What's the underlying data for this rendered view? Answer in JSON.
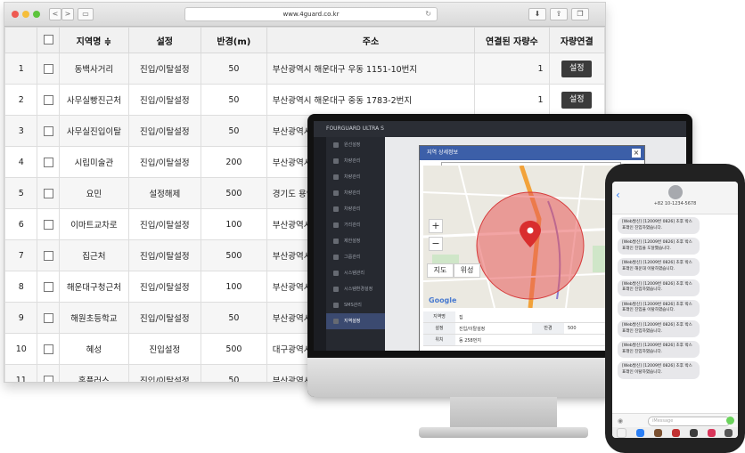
{
  "browser": {
    "url": "www.4guard.co.kr",
    "nav_back": "<",
    "nav_forward": ">"
  },
  "table": {
    "columns": [
      "지역명 ≑",
      "설정",
      "반경(m)",
      "주소",
      "연결된 자량수",
      "자량연결"
    ],
    "rows": [
      {
        "no": "1",
        "name": "동백사거리",
        "setting": "진입/이탈설정",
        "radius": "50",
        "address": "부산광역시 해운대구 우동 1151-10번지",
        "count": "1",
        "action": "설정"
      },
      {
        "no": "2",
        "name": "사무실빵진근처",
        "setting": "진입/이탈설정",
        "radius": "50",
        "address": "부산광역시 해운대구 중동 1783-2번지",
        "count": "1",
        "action": "설정"
      },
      {
        "no": "3",
        "name": "사무실진입이탈",
        "setting": "진입/이탈설정",
        "radius": "50",
        "address": "부산광역시 해운대구 중동",
        "count": "",
        "action": ""
      },
      {
        "no": "4",
        "name": "시립미술관",
        "setting": "진입/이탈설정",
        "radius": "200",
        "address": "부산광역시 ",
        "count": "",
        "action": ""
      },
      {
        "no": "5",
        "name": "요민",
        "setting": "설정해제",
        "radius": "500",
        "address": "경기도 용인",
        "count": "",
        "action": ""
      },
      {
        "no": "6",
        "name": "이마트교차로",
        "setting": "진입/이탈설정",
        "radius": "100",
        "address": "부산광역시 ",
        "count": "",
        "action": ""
      },
      {
        "no": "7",
        "name": "집근처",
        "setting": "진입/이탈설정",
        "radius": "500",
        "address": "부산광역시 ",
        "count": "",
        "action": ""
      },
      {
        "no": "8",
        "name": "해운대구청근처",
        "setting": "진입/이탈설정",
        "radius": "100",
        "address": "부산광역시 ",
        "count": "",
        "action": ""
      },
      {
        "no": "9",
        "name": "해원초등학교",
        "setting": "진입/이탈설정",
        "radius": "50",
        "address": "부산광역시 ",
        "count": "",
        "action": ""
      },
      {
        "no": "10",
        "name": "혜성",
        "setting": "진입설정",
        "radius": "500",
        "address": "대구광역시 ",
        "count": "",
        "action": ""
      },
      {
        "no": "11",
        "name": "홈플러스",
        "setting": "진입/이탈설정",
        "radius": "50",
        "address": "부산광역시 ",
        "count": "",
        "action": ""
      }
    ]
  },
  "monitor_app": {
    "brand": "FOURGUARD ULTRA S",
    "sidebar": [
      "원선설정",
      "차량관리",
      "차량관리",
      "차량관리",
      "차량관리",
      "거리관리",
      "제한설정",
      "그룹관리",
      "시스템관리",
      "시스템환경설정",
      "SMS관리",
      "지역설정"
    ],
    "dialog_title": "지역 상세정보",
    "map_type_map": "지도",
    "map_type_sat": "위성",
    "google_logo": "Google",
    "form_labels": [
      "지역명",
      "설정",
      "위치"
    ],
    "form_values": [
      "집",
      "진입/이탈설정",
      "동 258번지"
    ],
    "form_radius_label": "반경",
    "form_radius_value": "500"
  },
  "phone": {
    "contact": "+82 10-1234-5678",
    "input_placeholder": "iMessage",
    "messages": [
      "[Web발신] [12009번 0826] 초후 박스 표래인 진입하였습니다.",
      "[Web발신] [12009번 0826] 초후 박스 표래인 진입을 도달했습니다.",
      "[Web발신] [12009번 0826] 초후 박스 표래인 해운대 이탈하였습니다.",
      "[Web발신] [12009번 0826] 초후 박스 표래인 진입하였습니다.",
      "[Web발신] [12009번 0826] 초후 박스 표래인 진입을 이탈하였습니다.",
      "[Web발신] [12009번 0826] 초후 박스 표래인 진입하였습니다.",
      "[Web발신] [12009번 0826] 초후 박스 표래인 진입하였습니다.",
      "[Web발신] [12009번 0826] 초후 박스 표래인 이탈하였습니다."
    ]
  }
}
